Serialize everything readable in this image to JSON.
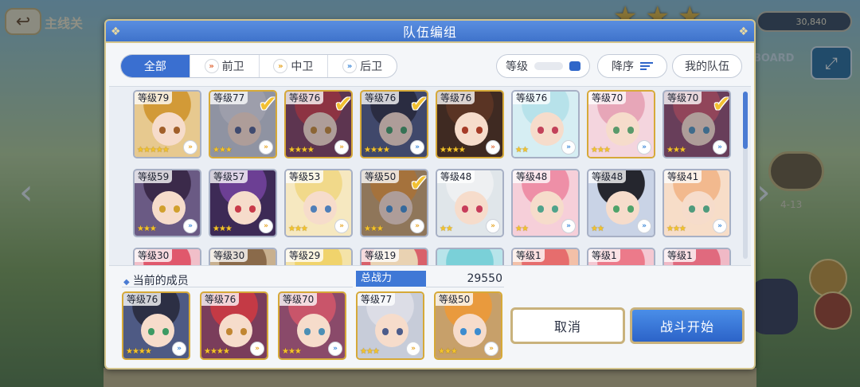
{
  "background": {
    "screen_title": "主线关",
    "gold_amount": "30,840",
    "map_label": "BOARD",
    "stage_number": "4-13"
  },
  "modal": {
    "title": "队伍编组",
    "tabs": [
      {
        "label": "全部",
        "icon": ""
      },
      {
        "label": "前卫",
        "icon": "front-role-icon"
      },
      {
        "label": "中卫",
        "icon": "middle-role-icon"
      },
      {
        "label": "后卫",
        "icon": "back-role-icon"
      }
    ],
    "sort_level_label": "等级",
    "sort_order_label": "降序",
    "my_team_label": "我的队伍"
  },
  "roster": [
    {
      "level": "等级79",
      "stars": "★★★★★",
      "role": "middle",
      "selected": false,
      "hair": "#d29a37",
      "bg": "#e7c98f",
      "eye": "#a1602a",
      "frame": "silver"
    },
    {
      "level": "等级77",
      "stars": "★★★",
      "role": "middle",
      "selected": true,
      "hair": "#dcdde6",
      "bg": "#c7ccd9",
      "eye": "#4c5c8b",
      "frame": "gold"
    },
    {
      "level": "等级76",
      "stars": "★★★★",
      "role": "middle",
      "selected": true,
      "hair": "#c43a45",
      "bg": "#7a3d5b",
      "eye": "#c18632",
      "frame": "gold"
    },
    {
      "level": "等级76",
      "stars": "★★★★",
      "role": "back",
      "selected": true,
      "hair": "#2c2f44",
      "bg": "#4e5a84",
      "eye": "#3d9a63",
      "frame": "gold"
    },
    {
      "level": "等级76",
      "stars": "★★★★",
      "role": "front",
      "selected": false,
      "hair": "#5a3424",
      "bg": "#3f2a22",
      "eye": "#a63b27",
      "frame": "gold"
    },
    {
      "level": "等级76",
      "stars": "★★",
      "role": "back",
      "selected": false,
      "hair": "#b7e2ea",
      "bg": "#d6eef3",
      "eye": "#c2425a",
      "frame": "silver"
    },
    {
      "level": "等级70",
      "stars": "★★★",
      "role": "back",
      "selected": false,
      "hair": "#e7a6b8",
      "bg": "#f4d5de",
      "eye": "#5a9a6b",
      "frame": "gold"
    },
    {
      "level": "等级70",
      "stars": "★★★",
      "role": "back",
      "selected": true,
      "hair": "#c9556a",
      "bg": "#8a4a6a",
      "eye": "#4c8fb5",
      "frame": "silver"
    },
    {
      "level": "等级59",
      "stars": "★★★",
      "role": "back",
      "selected": false,
      "hair": "#3b2a4a",
      "bg": "#6a5a84",
      "eye": "#d1a02e",
      "frame": "silver"
    },
    {
      "level": "等级57",
      "stars": "★★★",
      "role": "middle",
      "selected": false,
      "hair": "#6c3f94",
      "bg": "#3d2a56",
      "eye": "#c93a4a",
      "frame": "silver"
    },
    {
      "level": "等级53",
      "stars": "★★★",
      "role": "middle",
      "selected": false,
      "hair": "#f1d98a",
      "bg": "#f6e8c0",
      "eye": "#4f7fb8",
      "frame": "silver"
    },
    {
      "level": "等级50",
      "stars": "★★★",
      "role": "middle",
      "selected": true,
      "hair": "#e99a3d",
      "bg": "#c7a06a",
      "eye": "#3c8ccf",
      "frame": "silver"
    },
    {
      "level": "等级48",
      "stars": "★★",
      "role": "middle",
      "selected": false,
      "hair": "#eef0f2",
      "bg": "#e0e6ea",
      "eye": "#c73d5b",
      "frame": "silver"
    },
    {
      "level": "等级48",
      "stars": "★★",
      "role": "back",
      "selected": false,
      "hair": "#ee8fa7",
      "bg": "#f6cfd9",
      "eye": "#4fa38b",
      "frame": "silver"
    },
    {
      "level": "等级48",
      "stars": "★★",
      "role": "back",
      "selected": false,
      "hair": "#25262e",
      "bg": "#c9d3e6",
      "eye": "#4fa36a",
      "frame": "silver"
    },
    {
      "level": "等级41",
      "stars": "★★★",
      "role": "back",
      "selected": false,
      "hair": "#f2b98e",
      "bg": "#f7ddc8",
      "eye": "#4f9b7d",
      "frame": "silver"
    },
    {
      "level": "等级30",
      "stars": "",
      "role": "",
      "selected": false,
      "hair": "#e0586c",
      "bg": "#f1bfc9",
      "eye": "#666",
      "frame": "silver"
    },
    {
      "level": "等级30",
      "stars": "",
      "role": "",
      "selected": false,
      "hair": "#8a6a4a",
      "bg": "#c8b08f",
      "eye": "#666",
      "frame": "silver"
    },
    {
      "level": "等级29",
      "stars": "",
      "role": "",
      "selected": false,
      "hair": "#f0d36c",
      "bg": "#f4e3a8",
      "eye": "#666",
      "frame": "silver"
    },
    {
      "level": "等级19",
      "stars": "",
      "role": "",
      "selected": false,
      "hair": "#e9d2b2",
      "bg": "#d9606a",
      "eye": "#666",
      "frame": "silver"
    },
    {
      "level": "",
      "stars": "",
      "role": "",
      "selected": false,
      "hair": "#7ad0d8",
      "bg": "#b8e4ea",
      "eye": "#666",
      "frame": "silver"
    },
    {
      "level": "等级1",
      "stars": "",
      "role": "",
      "selected": false,
      "hair": "#e66d6d",
      "bg": "#f3c0a8",
      "eye": "#666",
      "frame": "silver"
    },
    {
      "level": "等级1",
      "stars": "",
      "role": "",
      "selected": false,
      "hair": "#ec7a8a",
      "bg": "#f4c8d2",
      "eye": "#666",
      "frame": "silver"
    },
    {
      "level": "等级1",
      "stars": "",
      "role": "",
      "selected": false,
      "hair": "#e06a7e",
      "bg": "#f0b9c6",
      "eye": "#666",
      "frame": "silver"
    }
  ],
  "current_members": {
    "label": "当前的成员",
    "power_label": "总战力",
    "power_value": "29550",
    "members": [
      {
        "level": "等级76",
        "stars": "★★★★",
        "role": "back",
        "hair": "#2c2f44",
        "bg": "#4e5a84",
        "eye": "#3d9a63"
      },
      {
        "level": "等级76",
        "stars": "★★★★",
        "role": "middle",
        "hair": "#c43a45",
        "bg": "#7a3d5b",
        "eye": "#c18632"
      },
      {
        "level": "等级70",
        "stars": "★★★",
        "role": "back",
        "hair": "#c9556a",
        "bg": "#8a4a6a",
        "eye": "#4c8fb5"
      },
      {
        "level": "等级77",
        "stars": "★★★",
        "role": "middle",
        "hair": "#dcdde6",
        "bg": "#c7ccd9",
        "eye": "#4c5c8b"
      },
      {
        "level": "等级50",
        "stars": "★★★",
        "role": "middle",
        "hair": "#e99a3d",
        "bg": "#c7a06a",
        "eye": "#3c8ccf"
      }
    ]
  },
  "buttons": {
    "cancel": "取消",
    "start": "战斗开始"
  },
  "role_glyph": "»",
  "check_glyph": "✔",
  "colors": {
    "accent_blue": "#3a6fd0",
    "gold_frame": "#d6a938",
    "role_front": "#e06a3a",
    "role_middle": "#e5a220",
    "role_back": "#3a86d6"
  }
}
